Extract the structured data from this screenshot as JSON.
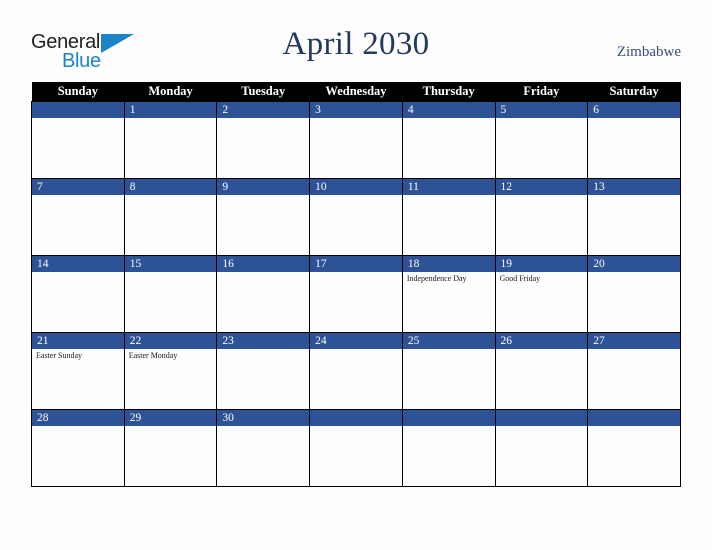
{
  "brand": {
    "name_part1": "General",
    "name_part2": "Blue",
    "triangle_color": "#1c84c6",
    "text_color": "#231f20"
  },
  "header": {
    "title": "April 2030",
    "country": "Zimbabwe",
    "title_color": "#23395f"
  },
  "calendar": {
    "weekday_headers": [
      "Sunday",
      "Monday",
      "Tuesday",
      "Wednesday",
      "Thursday",
      "Friday",
      "Saturday"
    ],
    "header_bg": "#000000",
    "daybar_bg": "#2d5295",
    "cell_bg": "#fdfdfd",
    "weeks": [
      [
        {
          "day": "",
          "events": []
        },
        {
          "day": "1",
          "events": []
        },
        {
          "day": "2",
          "events": []
        },
        {
          "day": "3",
          "events": []
        },
        {
          "day": "4",
          "events": []
        },
        {
          "day": "5",
          "events": []
        },
        {
          "day": "6",
          "events": []
        }
      ],
      [
        {
          "day": "7",
          "events": []
        },
        {
          "day": "8",
          "events": []
        },
        {
          "day": "9",
          "events": []
        },
        {
          "day": "10",
          "events": []
        },
        {
          "day": "11",
          "events": []
        },
        {
          "day": "12",
          "events": []
        },
        {
          "day": "13",
          "events": []
        }
      ],
      [
        {
          "day": "14",
          "events": []
        },
        {
          "day": "15",
          "events": []
        },
        {
          "day": "16",
          "events": []
        },
        {
          "day": "17",
          "events": []
        },
        {
          "day": "18",
          "events": [
            "Independence Day"
          ]
        },
        {
          "day": "19",
          "events": [
            "Good Friday"
          ]
        },
        {
          "day": "20",
          "events": []
        }
      ],
      [
        {
          "day": "21",
          "events": [
            "Easter Sunday"
          ]
        },
        {
          "day": "22",
          "events": [
            "Easter Monday"
          ]
        },
        {
          "day": "23",
          "events": []
        },
        {
          "day": "24",
          "events": []
        },
        {
          "day": "25",
          "events": []
        },
        {
          "day": "26",
          "events": []
        },
        {
          "day": "27",
          "events": []
        }
      ],
      [
        {
          "day": "28",
          "events": []
        },
        {
          "day": "29",
          "events": []
        },
        {
          "day": "30",
          "events": []
        },
        {
          "day": "",
          "events": []
        },
        {
          "day": "",
          "events": []
        },
        {
          "day": "",
          "events": []
        },
        {
          "day": "",
          "events": []
        }
      ]
    ]
  }
}
